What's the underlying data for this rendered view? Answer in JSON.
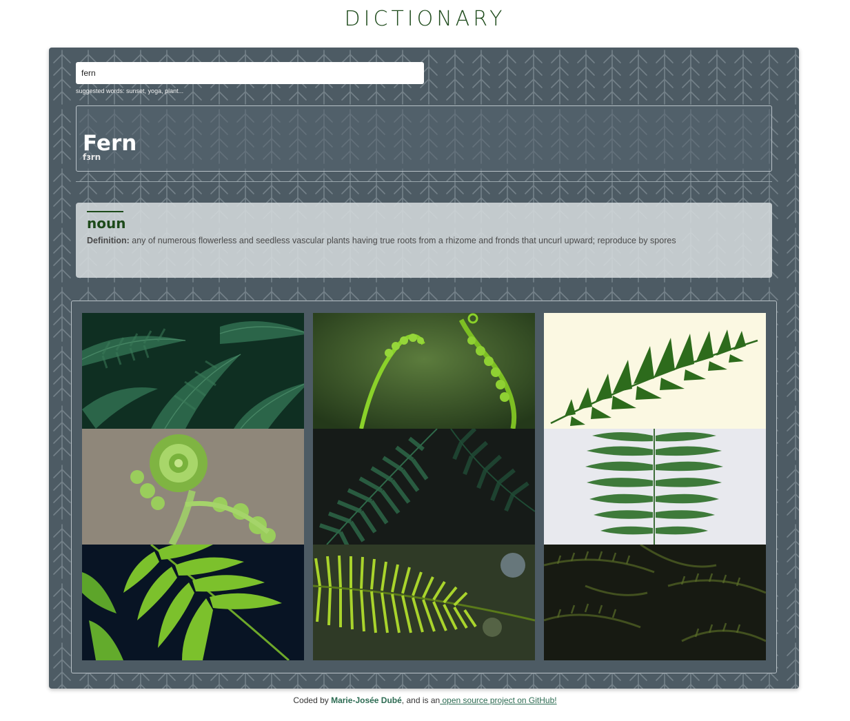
{
  "header": {
    "title": "DICTIONARY"
  },
  "search": {
    "value": "fern",
    "suggested": "suggested words: sunset, yoga, plant..."
  },
  "word": {
    "title": "Fern",
    "phonetic": "fɜrn"
  },
  "meaning": {
    "part_of_speech": "noun",
    "definition_label": "Definition:",
    "definition_text": " any of numerous flowerless and seedless vascular plants having true roots from a rhizome and fronds that uncurl upward; reproduce by spores"
  },
  "gallery": {
    "photos": [
      "dense-dark-green-ferns",
      "uncurling-fern-tendrils",
      "single-fern-frond-on-cream",
      "fiddlehead-fern-spiral",
      "dark-fern-fronds",
      "fern-leaf-on-white",
      "bright-green-fern-leaves",
      "backlit-fern-frond",
      "dark-fern-canopy"
    ]
  },
  "footer": {
    "prefix": "Coded by ",
    "author": "Marie-Josée Dubé",
    "middle": ", and is an",
    "link_text": " open source project on GitHub!"
  },
  "colors": {
    "title": "#1d4a1a",
    "card_background": "#4d5b64",
    "part_of_speech": "#1d4a1a",
    "link": "#2c6b52"
  }
}
